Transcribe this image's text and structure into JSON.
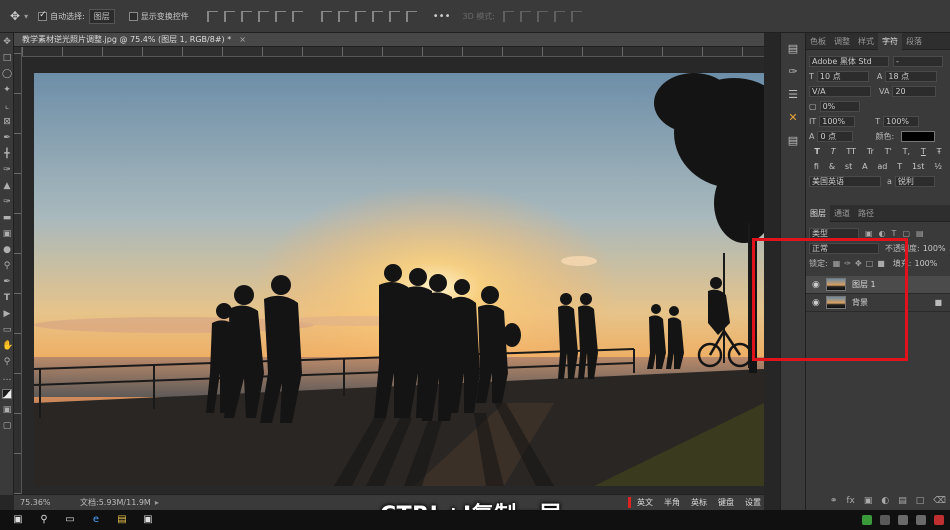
{
  "options_bar": {
    "auto_select_label": "自动选择:",
    "auto_select_value": "图层",
    "show_transform_label": "显示变换控件",
    "mode_3d_label": "3D 模式:"
  },
  "document": {
    "tab_title": "教学素材逆光照片调整.jpg @ 75.4% (图层 1, RGB/8#) *",
    "zoom": "75.36%",
    "doc_info": "文档:5.93M/11.9M"
  },
  "panels": {
    "top_tabs": [
      "色板",
      "调整",
      "样式",
      "字符",
      "段落"
    ],
    "active_top_tab": 3,
    "character": {
      "font_family": "Adobe 黑体 Std",
      "font_style": "-",
      "font_size": "10 点",
      "leading": "18 点",
      "kerning": "V/A",
      "tracking": "20",
      "tsume": "0%",
      "vscale": "100%",
      "hscale": "100%",
      "baseline": "0 点",
      "color_label": "颜色:",
      "language": "美国英语",
      "antialias_prefix": "a",
      "antialias": "锐利",
      "style_buttons": [
        "T",
        "T",
        "TT",
        "Tr",
        "T'",
        "T,",
        "T",
        "Ŧ"
      ],
      "opentype_buttons": [
        "fi",
        "&",
        "st",
        "A",
        "ad",
        "T",
        "1st",
        "½"
      ]
    },
    "layers_tabs": [
      "图层",
      "通道",
      "路径"
    ],
    "active_layers_tab": 0,
    "filter_label": "类型",
    "blend_mode": "正常",
    "opacity_label": "不透明度:",
    "opacity_value": "100%",
    "lock_label": "锁定:",
    "fill_label": "填充:",
    "fill_value": "100%",
    "layers": [
      {
        "name": "图层 1",
        "selected": true,
        "locked": false
      },
      {
        "name": "背景",
        "selected": false,
        "locked": true
      }
    ]
  },
  "ime": {
    "items": [
      "英文",
      "半角",
      "英标",
      "键盘",
      "设置"
    ]
  },
  "subtitle": "CTRL+J复制一层",
  "colors": {
    "highlight_box": "#e0121c",
    "accent_orange": "#e8a23a",
    "panel_bg": "#3a3a3a"
  },
  "icons": {
    "move": "move-icon",
    "eye": "eye-icon",
    "lock": "lock-icon"
  }
}
